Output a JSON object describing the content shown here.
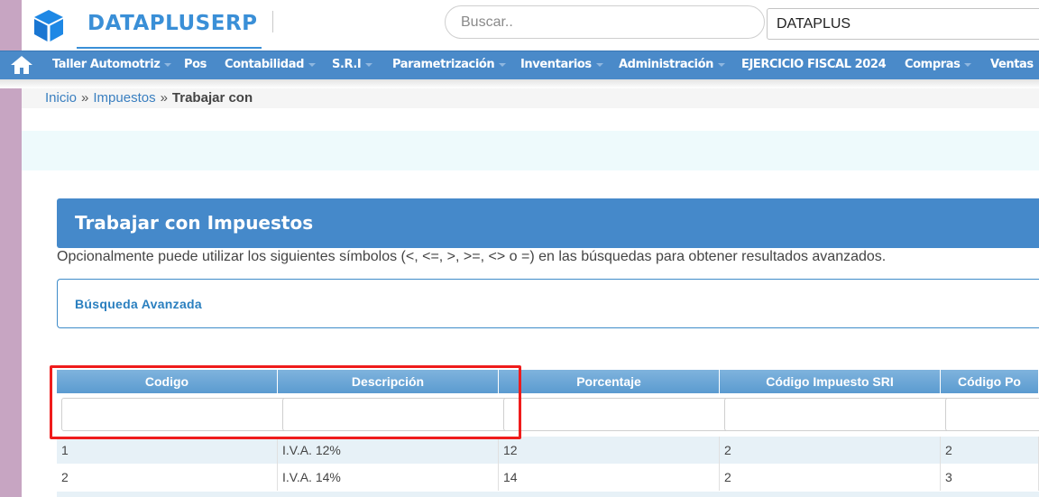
{
  "header": {
    "brand": "DATAPLUSERP",
    "search_placeholder": "Buscar..",
    "company": "DATAPLUS"
  },
  "nav": {
    "items": [
      {
        "label": "Taller Automotriz",
        "caret": true
      },
      {
        "label": "Pos",
        "caret": false
      },
      {
        "label": "Contabilidad",
        "caret": true
      },
      {
        "label": "S.R.I",
        "caret": true
      },
      {
        "label": "Parametrización",
        "caret": true
      },
      {
        "label": "Inventarios",
        "caret": true
      },
      {
        "label": "Administración",
        "caret": true
      },
      {
        "label": "EJERCICIO FISCAL 2024",
        "caret": false
      },
      {
        "label": "Compras",
        "caret": true
      },
      {
        "label": "Ventas",
        "caret": false
      }
    ]
  },
  "breadcrumb": {
    "home": "Inicio",
    "section": "Impuestos",
    "separator": "»",
    "current": "Trabajar con"
  },
  "panel": {
    "title": "Trabajar con Impuestos",
    "hint": "Opcionalmente puede utilizar los siguientes símbolos (<, <=, >, >=, <> o =) en las búsquedas para obtener resultados avanzados.",
    "advanced_search": "Búsqueda Avanzada"
  },
  "grid": {
    "columns": [
      "Codigo",
      "Descripción",
      "Porcentaje",
      "Código Impuesto SRI",
      "Código Po"
    ],
    "rows": [
      [
        "1",
        "I.V.A. 12%",
        "12",
        "2",
        "2"
      ],
      [
        "2",
        "I.V.A. 14%",
        "14",
        "2",
        "3"
      ]
    ]
  },
  "colors": {
    "accent": "#4589ca",
    "nav": "#4a8ac9",
    "highlight": "#ef1c1c"
  }
}
